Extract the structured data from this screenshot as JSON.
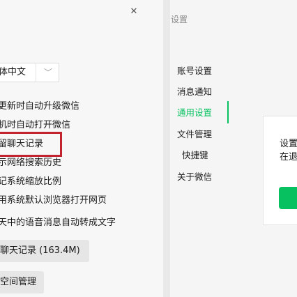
{
  "left_panel": {
    "close_glyph": "✕",
    "language_select": {
      "value": "体中文",
      "chevron": "﹀"
    },
    "options": [
      "更新时自动升级微信",
      "机时自动打开微信",
      "留聊天记录",
      "示网络搜索历史",
      "记系统缩放比例",
      "用系统默认浏览器打开网页",
      "天中的语音消息自动转成文字"
    ],
    "highlighted_option_index": 2,
    "highlight_color": "#c2232e",
    "buttons": {
      "chat_history": "聊天记录 (163.4M)",
      "storage": "空间管理"
    }
  },
  "right_window": {
    "title": "设置",
    "accent_color": "#07c160",
    "nav": [
      "账号设置",
      "消息通知",
      "通用设置",
      "文件管理",
      "快捷键",
      "关于微信"
    ],
    "active_nav_index": 2,
    "dialog": {
      "line1": "设置",
      "line2": "在退",
      "confirm_color": "#07c160"
    }
  }
}
